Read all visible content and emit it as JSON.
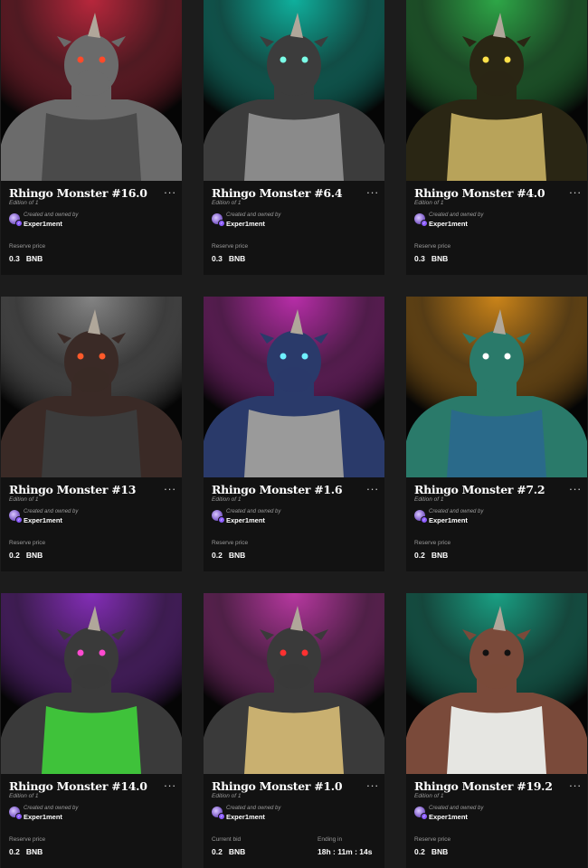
{
  "cards": [
    {
      "title": "Rhingo Monster #16.0",
      "edition": "Edition of 1",
      "owner_label": "Created and owned by",
      "owner": "Exper1ment",
      "price_label": "Reserve price",
      "price": "0.3",
      "currency": "BNB",
      "menu": "...",
      "art": {
        "spot": "#c0283e",
        "eyes": "#ff4a2a",
        "body": "#6b6b6b",
        "vest": "#4a4a4a"
      }
    },
    {
      "title": "Rhingo Monster #6.4",
      "edition": "Edition of 1",
      "owner_label": "Created and owned by",
      "owner": "Exper1ment",
      "price_label": "Reserve price",
      "price": "0.3",
      "currency": "BNB",
      "menu": "...",
      "art": {
        "spot": "#0fb8a4",
        "eyes": "#7bffe8",
        "body": "#3c3c3c",
        "vest": "#8a8a8a"
      }
    },
    {
      "title": "Rhingo Monster #4.0",
      "edition": "Edition of 1",
      "owner_label": "Created and owned by",
      "owner": "Exper1ment",
      "price_label": "Reserve price",
      "price": "0.3",
      "currency": "BNB",
      "menu": "...",
      "art": {
        "spot": "#2fae4a",
        "eyes": "#ffe14a",
        "body": "#2a2614",
        "vest": "#b8a35a"
      }
    },
    {
      "title": "Rhingo Monster #13",
      "edition": "Edition of 1",
      "owner_label": "Created and owned by",
      "owner": "Exper1ment",
      "price_label": "Reserve price",
      "price": "0.2",
      "currency": "BNB",
      "menu": "...",
      "art": {
        "spot": "#8a8a8a",
        "eyes": "#ff5a2a",
        "body": "#3a2a26",
        "vest": "#3b3b3b"
      }
    },
    {
      "title": "Rhingo Monster #1.6",
      "edition": "Edition of 1",
      "owner_label": "Created and owned by",
      "owner": "Exper1ment",
      "price_label": "Reserve price",
      "price": "0.2",
      "currency": "BNB",
      "menu": "...",
      "art": {
        "spot": "#c02fb0",
        "eyes": "#6ff0ff",
        "body": "#2a3a6a",
        "vest": "#9a9a9a"
      }
    },
    {
      "title": "Rhingo Monster #7.2",
      "edition": "Edition of 1",
      "owner_label": "Created and owned by",
      "owner": "Exper1ment",
      "price_label": "Reserve price",
      "price": "0.2",
      "currency": "BNB",
      "menu": "...",
      "art": {
        "spot": "#d48a1a",
        "eyes": "#ffffff",
        "body": "#2a7a6a",
        "vest": "#2a6a8a"
      }
    },
    {
      "title": "Rhingo Monster #14.0",
      "edition": "Edition of 1",
      "owner_label": "Created and owned by",
      "owner": "Exper1ment",
      "price_label": "Reserve price",
      "price": "0.2",
      "currency": "BNB",
      "menu": "...",
      "art": {
        "spot": "#8a2fc0",
        "eyes": "#ff4ad0",
        "body": "#3a3a3a",
        "vest": "#3fc23a"
      }
    },
    {
      "title": "Rhingo Monster #1.0",
      "edition": "Edition of 1",
      "owner_label": "Created and owned by",
      "owner": "Exper1ment",
      "price_label": "Current bid",
      "price": "0.2",
      "currency": "BNB",
      "menu": "...",
      "end_label": "Ending in",
      "end_value": "18h : 11m : 14s",
      "art": {
        "spot": "#c03aa8",
        "eyes": "#ff3030",
        "body": "#3a3a3a",
        "vest": "#c9b070"
      }
    },
    {
      "title": "Rhingo Monster #19.2",
      "edition": "Edition of 1",
      "owner_label": "Created and owned by",
      "owner": "Exper1ment",
      "price_label": "Reserve price",
      "price": "0.2",
      "currency": "BNB",
      "menu": "...",
      "art": {
        "spot": "#1aa88a",
        "eyes": "#111111",
        "body": "#7a4a3a",
        "vest": "#e6e6e2"
      }
    }
  ]
}
